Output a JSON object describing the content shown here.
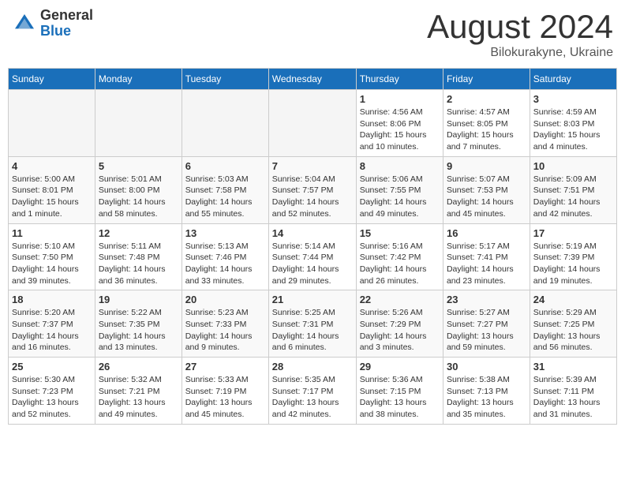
{
  "header": {
    "logo_general": "General",
    "logo_blue": "Blue",
    "month_title": "August 2024",
    "location": "Bilokurakyne, Ukraine"
  },
  "days_of_week": [
    "Sunday",
    "Monday",
    "Tuesday",
    "Wednesday",
    "Thursday",
    "Friday",
    "Saturday"
  ],
  "weeks": [
    [
      {
        "day": "",
        "info": ""
      },
      {
        "day": "",
        "info": ""
      },
      {
        "day": "",
        "info": ""
      },
      {
        "day": "",
        "info": ""
      },
      {
        "day": "1",
        "info": "Sunrise: 4:56 AM\nSunset: 8:06 PM\nDaylight: 15 hours\nand 10 minutes."
      },
      {
        "day": "2",
        "info": "Sunrise: 4:57 AM\nSunset: 8:05 PM\nDaylight: 15 hours\nand 7 minutes."
      },
      {
        "day": "3",
        "info": "Sunrise: 4:59 AM\nSunset: 8:03 PM\nDaylight: 15 hours\nand 4 minutes."
      }
    ],
    [
      {
        "day": "4",
        "info": "Sunrise: 5:00 AM\nSunset: 8:01 PM\nDaylight: 15 hours\nand 1 minute."
      },
      {
        "day": "5",
        "info": "Sunrise: 5:01 AM\nSunset: 8:00 PM\nDaylight: 14 hours\nand 58 minutes."
      },
      {
        "day": "6",
        "info": "Sunrise: 5:03 AM\nSunset: 7:58 PM\nDaylight: 14 hours\nand 55 minutes."
      },
      {
        "day": "7",
        "info": "Sunrise: 5:04 AM\nSunset: 7:57 PM\nDaylight: 14 hours\nand 52 minutes."
      },
      {
        "day": "8",
        "info": "Sunrise: 5:06 AM\nSunset: 7:55 PM\nDaylight: 14 hours\nand 49 minutes."
      },
      {
        "day": "9",
        "info": "Sunrise: 5:07 AM\nSunset: 7:53 PM\nDaylight: 14 hours\nand 45 minutes."
      },
      {
        "day": "10",
        "info": "Sunrise: 5:09 AM\nSunset: 7:51 PM\nDaylight: 14 hours\nand 42 minutes."
      }
    ],
    [
      {
        "day": "11",
        "info": "Sunrise: 5:10 AM\nSunset: 7:50 PM\nDaylight: 14 hours\nand 39 minutes."
      },
      {
        "day": "12",
        "info": "Sunrise: 5:11 AM\nSunset: 7:48 PM\nDaylight: 14 hours\nand 36 minutes."
      },
      {
        "day": "13",
        "info": "Sunrise: 5:13 AM\nSunset: 7:46 PM\nDaylight: 14 hours\nand 33 minutes."
      },
      {
        "day": "14",
        "info": "Sunrise: 5:14 AM\nSunset: 7:44 PM\nDaylight: 14 hours\nand 29 minutes."
      },
      {
        "day": "15",
        "info": "Sunrise: 5:16 AM\nSunset: 7:42 PM\nDaylight: 14 hours\nand 26 minutes."
      },
      {
        "day": "16",
        "info": "Sunrise: 5:17 AM\nSunset: 7:41 PM\nDaylight: 14 hours\nand 23 minutes."
      },
      {
        "day": "17",
        "info": "Sunrise: 5:19 AM\nSunset: 7:39 PM\nDaylight: 14 hours\nand 19 minutes."
      }
    ],
    [
      {
        "day": "18",
        "info": "Sunrise: 5:20 AM\nSunset: 7:37 PM\nDaylight: 14 hours\nand 16 minutes."
      },
      {
        "day": "19",
        "info": "Sunrise: 5:22 AM\nSunset: 7:35 PM\nDaylight: 14 hours\nand 13 minutes."
      },
      {
        "day": "20",
        "info": "Sunrise: 5:23 AM\nSunset: 7:33 PM\nDaylight: 14 hours\nand 9 minutes."
      },
      {
        "day": "21",
        "info": "Sunrise: 5:25 AM\nSunset: 7:31 PM\nDaylight: 14 hours\nand 6 minutes."
      },
      {
        "day": "22",
        "info": "Sunrise: 5:26 AM\nSunset: 7:29 PM\nDaylight: 14 hours\nand 3 minutes."
      },
      {
        "day": "23",
        "info": "Sunrise: 5:27 AM\nSunset: 7:27 PM\nDaylight: 13 hours\nand 59 minutes."
      },
      {
        "day": "24",
        "info": "Sunrise: 5:29 AM\nSunset: 7:25 PM\nDaylight: 13 hours\nand 56 minutes."
      }
    ],
    [
      {
        "day": "25",
        "info": "Sunrise: 5:30 AM\nSunset: 7:23 PM\nDaylight: 13 hours\nand 52 minutes."
      },
      {
        "day": "26",
        "info": "Sunrise: 5:32 AM\nSunset: 7:21 PM\nDaylight: 13 hours\nand 49 minutes."
      },
      {
        "day": "27",
        "info": "Sunrise: 5:33 AM\nSunset: 7:19 PM\nDaylight: 13 hours\nand 45 minutes."
      },
      {
        "day": "28",
        "info": "Sunrise: 5:35 AM\nSunset: 7:17 PM\nDaylight: 13 hours\nand 42 minutes."
      },
      {
        "day": "29",
        "info": "Sunrise: 5:36 AM\nSunset: 7:15 PM\nDaylight: 13 hours\nand 38 minutes."
      },
      {
        "day": "30",
        "info": "Sunrise: 5:38 AM\nSunset: 7:13 PM\nDaylight: 13 hours\nand 35 minutes."
      },
      {
        "day": "31",
        "info": "Sunrise: 5:39 AM\nSunset: 7:11 PM\nDaylight: 13 hours\nand 31 minutes."
      }
    ]
  ]
}
